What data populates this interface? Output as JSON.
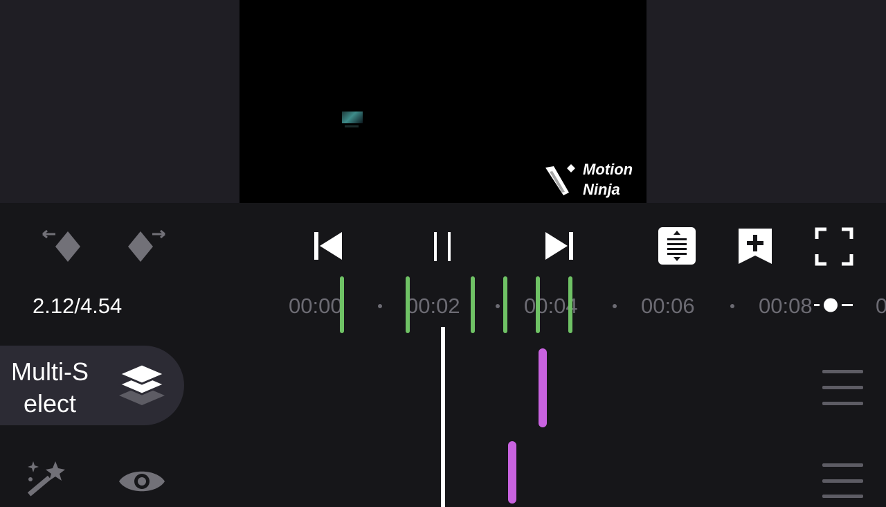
{
  "preview": {
    "watermark": {
      "line1": "Motion",
      "line2": "Ninja"
    }
  },
  "toolbar": {
    "icons": [
      "prev-keyframe-icon",
      "next-keyframe-icon",
      "skip-to-start-icon",
      "pause-icon",
      "skip-to-end-icon",
      "track-height-icon",
      "add-bookmark-icon",
      "fullscreen-icon"
    ]
  },
  "timeline": {
    "current_time": "2.12/4.54",
    "ruler_labels": [
      "00:00",
      "00:02",
      "00:04",
      "00:06",
      "00:08",
      "0"
    ],
    "zoom": "zoom-slider-icon"
  },
  "sidebar": {
    "multi_select_label": "Multi-S elect",
    "layers_icon": "layers-icon",
    "magic_icon": "magic-wand-icon",
    "visibility_icon": "eye-icon"
  },
  "tracks": {
    "handle_icon": "drag-handle-icon"
  },
  "colors": {
    "background": "#161619",
    "preview_background": "#1f1e24",
    "keyframe_marker": "#6fc265",
    "clip_marker": "#c963e0",
    "ruler_text": "#6c6b73",
    "multi_select_bg": "#2c2b34"
  }
}
